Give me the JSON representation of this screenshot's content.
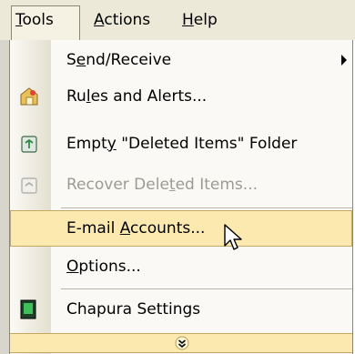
{
  "menubar": {
    "items": [
      {
        "prefix": "",
        "accel": "T",
        "rest": "ools"
      },
      {
        "prefix": "",
        "accel": "A",
        "rest": "ctions"
      },
      {
        "prefix": "",
        "accel": "H",
        "rest": "elp"
      }
    ]
  },
  "menu": {
    "items": [
      {
        "pre": "S",
        "accel": "e",
        "post": "nd/Receive",
        "icon": "none",
        "submenu": true
      },
      {
        "pre": "Ru",
        "accel": "l",
        "post": "es and Alerts...",
        "icon": "rules-alerts-icon"
      },
      {
        "pre": "Empt",
        "accel": "y",
        "post": " \"Deleted Items\" Folder",
        "icon": "recycle-bin-icon"
      },
      {
        "pre": "Recover Dele",
        "accel": "t",
        "post": "ed Items...",
        "icon": "recover-deleted-icon",
        "disabled": true
      },
      {
        "pre": "E-mail ",
        "accel": "A",
        "post": "ccounts...",
        "icon": "none",
        "highlighted": true
      },
      {
        "pre": "",
        "accel": "O",
        "post": "ptions...",
        "icon": "none"
      },
      {
        "pre": "Chapura Settings",
        "accel": "",
        "post": "",
        "icon": "chapura-icon"
      }
    ]
  },
  "colors": {
    "highlight": "#fbe9b0",
    "highlight_border": "#c6a663",
    "menubar": "#ece9d8"
  }
}
